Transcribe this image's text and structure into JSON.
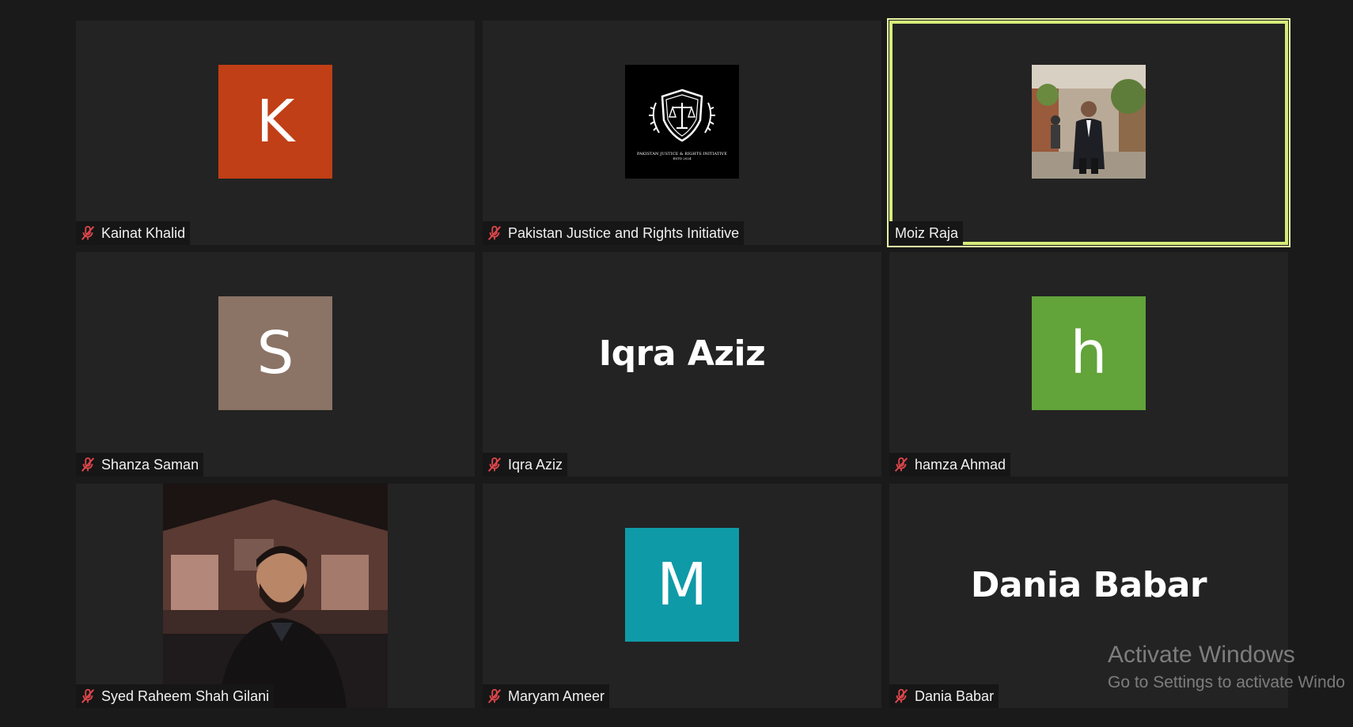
{
  "participants": [
    {
      "name": "Kainat Khalid",
      "avatar_letter": "K",
      "avatar_color": "#c03f16",
      "muted": true
    },
    {
      "name": "Pakistan Justice and Rights Initiative",
      "logo_text_1": "PAKISTAN JUSTICE & RIGHTS INITIATIVE",
      "logo_text_2": "ESTD 2024",
      "muted": true
    },
    {
      "name": "Moiz Raja",
      "muted": false,
      "active_speaker": true
    },
    {
      "name": "Shanza Saman",
      "avatar_letter": "S",
      "avatar_color": "#8b7466",
      "muted": true
    },
    {
      "name": "Iqra Aziz",
      "display_text": "Iqra Aziz",
      "muted": true
    },
    {
      "name": "hamza Ahmad",
      "avatar_letter": "h",
      "avatar_color": "#62a33a",
      "muted": true
    },
    {
      "name": "Syed Raheem Shah Gilani",
      "muted": true
    },
    {
      "name": "Maryam Ameer",
      "avatar_letter": "M",
      "avatar_color": "#0f9aa8",
      "muted": true
    },
    {
      "name": "Dania Babar",
      "display_text": "Dania Babar",
      "muted": true
    }
  ],
  "watermark": {
    "line1": "Activate Windows",
    "line2": "Go to Settings to activate Windo"
  },
  "colors": {
    "active_border": "#d6ec7a",
    "mute_icon": "#e0474c",
    "tile_bg": "#232323",
    "page_bg": "#1a1a1a"
  }
}
